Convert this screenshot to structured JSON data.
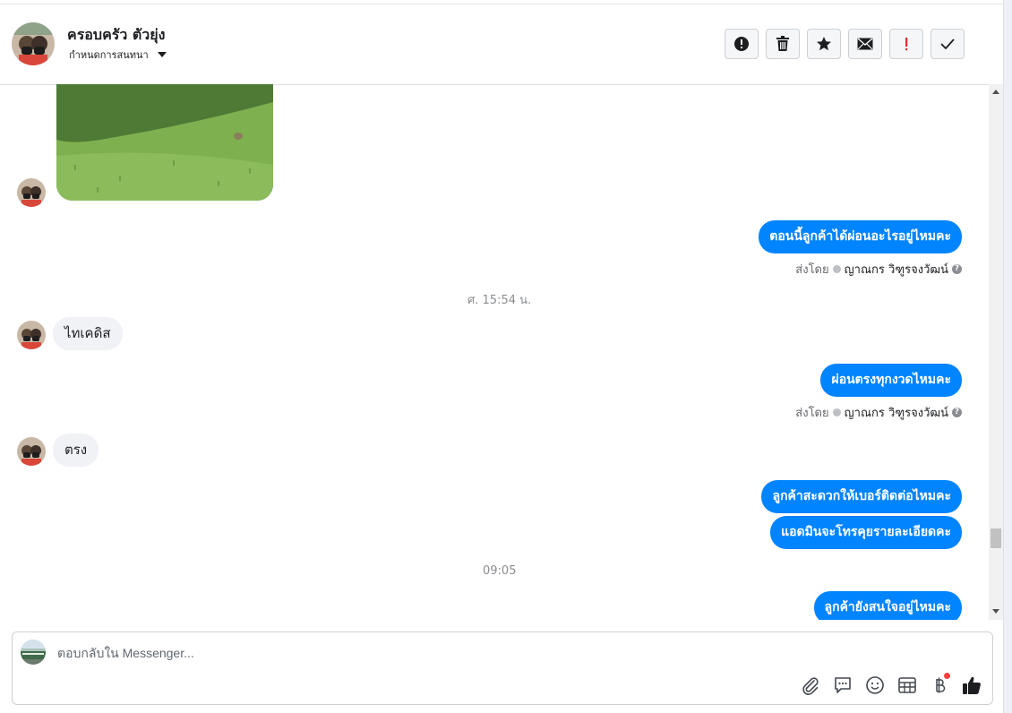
{
  "header": {
    "name": "ครอบครัว ตัวยุ่ง",
    "assign_label": "กำหนดการสนทนา"
  },
  "toolbar": {
    "buttons": [
      "alert-circle-icon",
      "trash-icon",
      "star-icon",
      "envelope-icon",
      "exclamation-icon",
      "checkmark-icon"
    ]
  },
  "thread": {
    "messages": [
      {
        "id": "m1",
        "direction": "outgoing",
        "text": "ตอนนี้ลูกค้าได้ผ่อนอะไรอยู่ไหมคะ",
        "sent_by_prefix": "ส่งโดย",
        "agent": "ญาณกร วิฑูรจงวัฒน์"
      },
      {
        "id": "t1",
        "type": "timestamp",
        "text": "ศ. 15:54 น."
      },
      {
        "id": "m2",
        "direction": "incoming",
        "text": "ไทเคดิส"
      },
      {
        "id": "m3",
        "direction": "outgoing",
        "text": "ผ่อนตรงทุกงวดไหมคะ",
        "sent_by_prefix": "ส่งโดย",
        "agent": "ญาณกร วิฑูรจงวัฒน์"
      },
      {
        "id": "m4",
        "direction": "incoming",
        "text": "ตรง"
      },
      {
        "id": "m5",
        "direction": "outgoing",
        "text": "ลูกค้าสะดวกให้เบอร์ติดต่อไหมคะ"
      },
      {
        "id": "m6",
        "direction": "outgoing",
        "text": "แอดมินจะโทรคุยรายละเอียดคะ"
      },
      {
        "id": "t2",
        "type": "timestamp",
        "text": "09:05"
      },
      {
        "id": "m7",
        "direction": "outgoing",
        "text": "ลูกค้ายังสนใจอยู่ไหมคะ"
      }
    ]
  },
  "composer": {
    "placeholder": "ตอบกลับใน Messenger...",
    "tools": [
      "paperclip-icon",
      "saved-reply-icon",
      "emoji-icon",
      "table-icon",
      "baht-icon",
      "thumbs-up-icon"
    ]
  },
  "colors": {
    "outgoing_bubble": "#0084ff",
    "incoming_bubble": "#f0f2f5",
    "notification_dot": "#fa3e3e"
  }
}
